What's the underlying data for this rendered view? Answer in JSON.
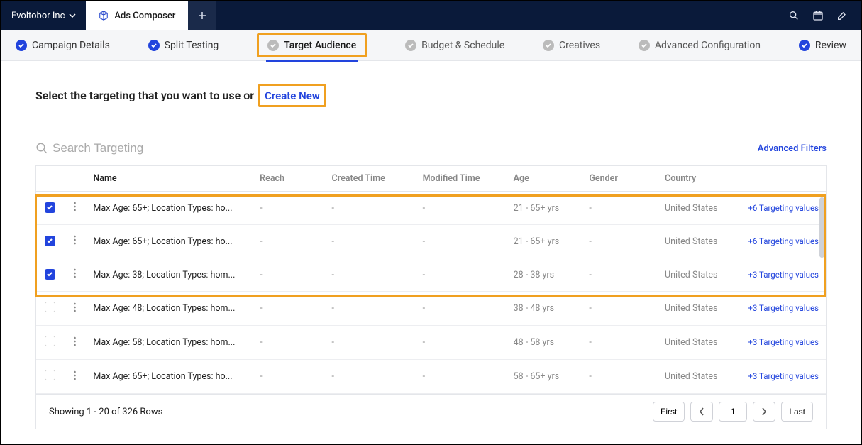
{
  "org": {
    "name": "Evoltobor Inc"
  },
  "tab": {
    "label": "Ads Composer"
  },
  "steps": [
    {
      "label": "Campaign Details",
      "state": "done"
    },
    {
      "label": "Split Testing",
      "state": "done"
    },
    {
      "label": "Target Audience",
      "state": "active"
    },
    {
      "label": "Budget & Schedule",
      "state": "pending"
    },
    {
      "label": "Creatives",
      "state": "pending"
    },
    {
      "label": "Advanced Configuration",
      "state": "pending"
    },
    {
      "label": "Review",
      "state": "done"
    }
  ],
  "prompt": {
    "text": "Select the targeting that you want to use or",
    "create": "Create New"
  },
  "search": {
    "placeholder": "Search Targeting"
  },
  "advanced_filters": "Advanced Filters",
  "columns": {
    "name": "Name",
    "reach": "Reach",
    "created": "Created Time",
    "modified": "Modified Time",
    "age": "Age",
    "gender": "Gender",
    "country": "Country"
  },
  "rows": [
    {
      "checked": true,
      "name": "Max Age: 65+; Location Types: ho...",
      "reach": "-",
      "created": "-",
      "modified": "-",
      "age": "21 - 65+ yrs",
      "gender": "-",
      "country": "United States",
      "link": "+6 Targeting values"
    },
    {
      "checked": true,
      "name": "Max Age: 65+; Location Types: ho...",
      "reach": "-",
      "created": "-",
      "modified": "-",
      "age": "21 - 65+ yrs",
      "gender": "-",
      "country": "United States",
      "link": "+6 Targeting values"
    },
    {
      "checked": true,
      "name": "Max Age: 38; Location Types: hom...",
      "reach": "-",
      "created": "-",
      "modified": "-",
      "age": "28 - 38 yrs",
      "gender": "-",
      "country": "United States",
      "link": "+3 Targeting values"
    },
    {
      "checked": false,
      "name": "Max Age: 48; Location Types: hom...",
      "reach": "-",
      "created": "-",
      "modified": "-",
      "age": "38 - 48 yrs",
      "gender": "-",
      "country": "United States",
      "link": "+3 Targeting values"
    },
    {
      "checked": false,
      "name": "Max Age: 58; Location Types: hom...",
      "reach": "-",
      "created": "-",
      "modified": "-",
      "age": "48 - 58 yrs",
      "gender": "-",
      "country": "United States",
      "link": "+3 Targeting values"
    },
    {
      "checked": false,
      "name": "Max Age: 65+; Location Types: ho...",
      "reach": "-",
      "created": "-",
      "modified": "-",
      "age": "58 - 65+ yrs",
      "gender": "-",
      "country": "United States",
      "link": "+3 Targeting values"
    }
  ],
  "pagination": {
    "summary": "Showing 1 - 20 of 326 Rows",
    "first": "First",
    "last": "Last",
    "page": "1"
  }
}
